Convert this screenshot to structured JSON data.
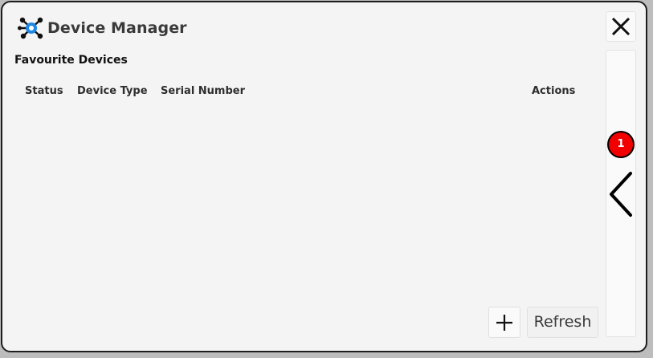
{
  "window": {
    "title": "Device Manager",
    "app_icon": "device-network-icon",
    "close_icon": "close-icon"
  },
  "favourites": {
    "section_title": "Favourite Devices",
    "columns": [
      "Status",
      "Device Type",
      "Serial Number",
      "Actions"
    ],
    "rows": []
  },
  "side_panel": {
    "badge_count": "1",
    "collapse_icon": "chevron-left-icon"
  },
  "actions": {
    "add_icon": "plus-icon",
    "refresh_label": "Refresh"
  },
  "colors": {
    "accent": "#1e88e5",
    "badge": "#f20000",
    "background": "#f4f4f4"
  }
}
